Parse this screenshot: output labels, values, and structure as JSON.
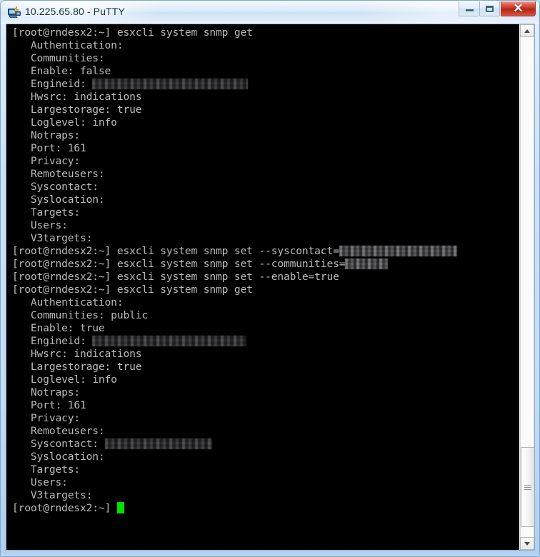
{
  "window": {
    "title": "10.225.65.80 - PuTTY",
    "app_icon": "putty-icon",
    "caption": {
      "minimize_label": "–",
      "maximize_label": "□",
      "close_label": "✕"
    }
  },
  "terminal": {
    "prompt": "[root@rndesx2:~]",
    "foreground_color": "#bbbbbb",
    "background_color": "#000000",
    "cursor_color": "#00e000",
    "lines": [
      {
        "type": "command",
        "text": "[root@rndesx2:~] esxcli system snmp get"
      },
      {
        "type": "output",
        "text": "   Authentication:"
      },
      {
        "type": "output",
        "text": "   Communities:"
      },
      {
        "type": "output",
        "text": "   Enable: false"
      },
      {
        "type": "output",
        "text": "   Engineid: ",
        "redacted_width": 218
      },
      {
        "type": "output",
        "text": "   Hwsrc: indications"
      },
      {
        "type": "output",
        "text": "   Largestorage: true"
      },
      {
        "type": "output",
        "text": "   Loglevel: info"
      },
      {
        "type": "output",
        "text": "   Notraps:"
      },
      {
        "type": "output",
        "text": "   Port: 161"
      },
      {
        "type": "output",
        "text": "   Privacy:"
      },
      {
        "type": "output",
        "text": "   Remoteusers:"
      },
      {
        "type": "output",
        "text": "   Syscontact:"
      },
      {
        "type": "output",
        "text": "   Syslocation:"
      },
      {
        "type": "output",
        "text": "   Targets:"
      },
      {
        "type": "output",
        "text": "   Users:"
      },
      {
        "type": "output",
        "text": "   V3targets:"
      },
      {
        "type": "command",
        "text": "[root@rndesx2:~] esxcli system snmp set --syscontact=",
        "redacted_width": 165
      },
      {
        "type": "command",
        "text": "[root@rndesx2:~] esxcli system snmp set --communities=",
        "redacted_width": 60
      },
      {
        "type": "command",
        "text": "[root@rndesx2:~] esxcli system snmp set --enable=true"
      },
      {
        "type": "command",
        "text": "[root@rndesx2:~] esxcli system snmp get"
      },
      {
        "type": "output",
        "text": "   Authentication:"
      },
      {
        "type": "output",
        "text": "   Communities: public"
      },
      {
        "type": "output",
        "text": "   Enable: true"
      },
      {
        "type": "output",
        "text": "   Engineid: ",
        "redacted_width": 216
      },
      {
        "type": "output",
        "text": "   Hwsrc: indications"
      },
      {
        "type": "output",
        "text": "   Largestorage: true"
      },
      {
        "type": "output",
        "text": "   Loglevel: info"
      },
      {
        "type": "output",
        "text": "   Notraps:"
      },
      {
        "type": "output",
        "text": "   Port: 161"
      },
      {
        "type": "output",
        "text": "   Privacy:"
      },
      {
        "type": "output",
        "text": "   Remoteusers:"
      },
      {
        "type": "output",
        "text": "   Syscontact: ",
        "redacted_width": 150
      },
      {
        "type": "output",
        "text": "   Syslocation:"
      },
      {
        "type": "output",
        "text": "   Targets:"
      },
      {
        "type": "output",
        "text": "   Users:"
      },
      {
        "type": "output",
        "text": "   V3targets:"
      },
      {
        "type": "prompt_cursor",
        "text": "[root@rndesx2:~] ",
        "cursor": true
      }
    ]
  },
  "scrollbar": {
    "up_arrow": "scroll-up-arrow",
    "down_arrow": "scroll-down-arrow",
    "thumb_top_pct": 82,
    "thumb_height_pct": 16
  }
}
